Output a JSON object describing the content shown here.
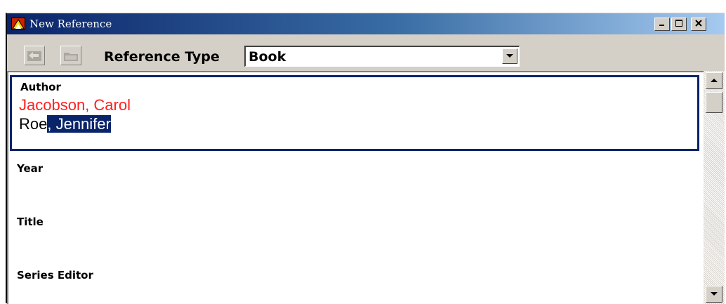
{
  "window": {
    "title": "New Reference",
    "title_bar_color": "#0a246a",
    "icon": "endnote-app-icon"
  },
  "caption_buttons": [
    "minimize-icon",
    "maximize-icon",
    "close-icon"
  ],
  "toolbar": {
    "buttons": [
      "back-arrow-icon",
      "folder-icon"
    ],
    "reference_type_label": "Reference Type",
    "reference_type_value": "Book"
  },
  "fields": [
    {
      "label": "Author",
      "lines": [
        {
          "text": "Jacobson, Carol",
          "color": "#ff2020"
        },
        {
          "prefix": "Roe",
          "selected": ", Jennifer"
        }
      ]
    },
    {
      "label": "Year"
    },
    {
      "label": "Title"
    },
    {
      "label": "Series Editor"
    }
  ],
  "colors": {
    "selection_bg": "#0a246a",
    "focus_border": "#0a246a",
    "author_new_text": "#ff2020"
  }
}
